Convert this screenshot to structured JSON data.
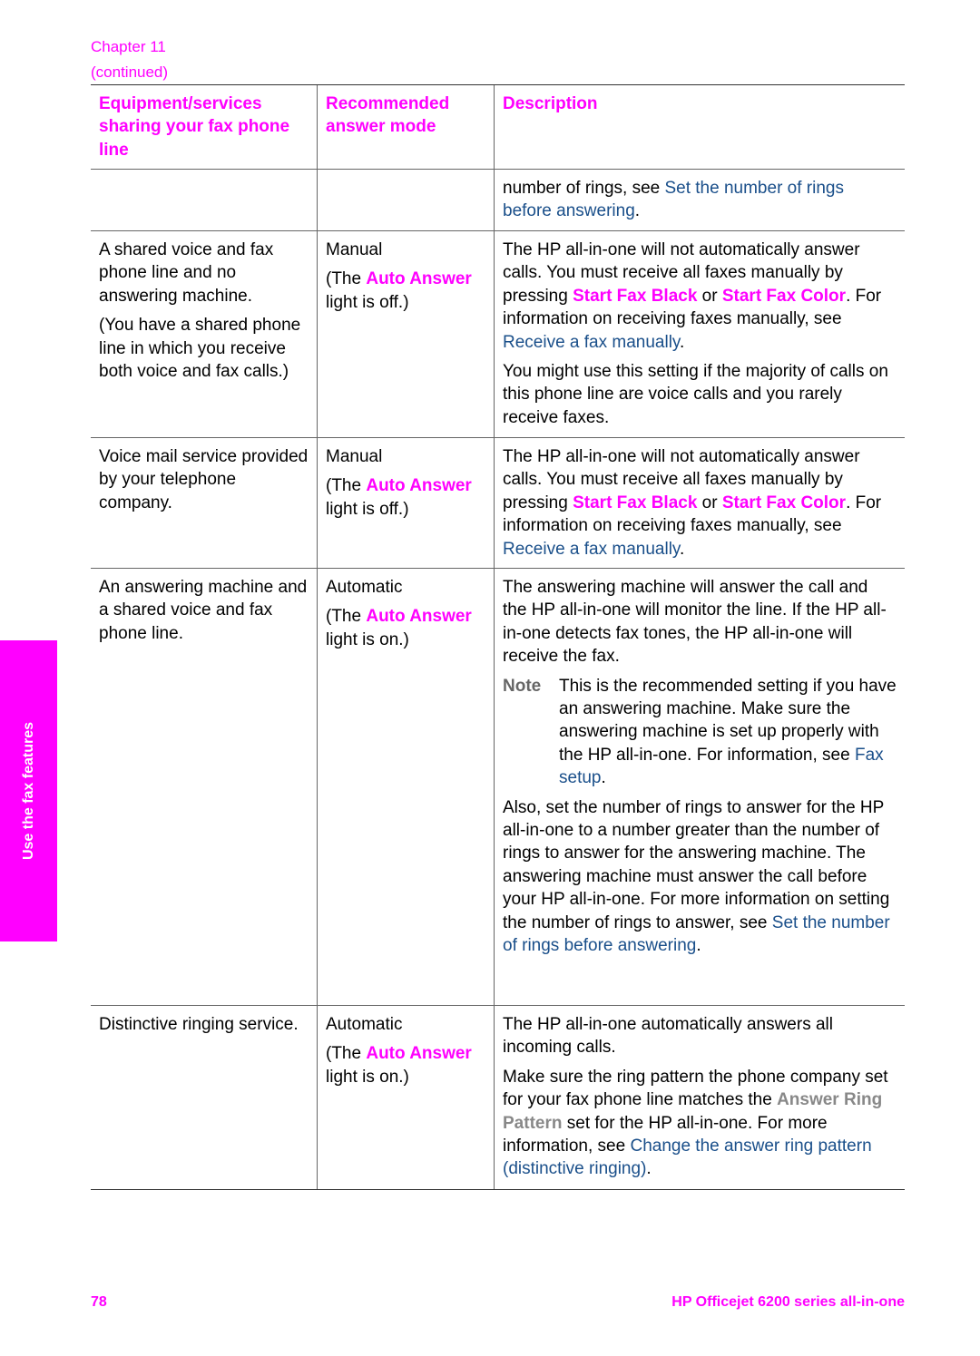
{
  "header": {
    "chapter": "Chapter 11",
    "continued": "(continued)"
  },
  "side_tab": {
    "label": "Use the fax features"
  },
  "table": {
    "headers": [
      "Equipment/services sharing your fax phone line",
      "Recommended answer mode",
      "Description"
    ],
    "rows": [
      {
        "equipment": "",
        "mode": "",
        "desc_prefix": "number of rings, see ",
        "desc_link": "Set the number of rings before answering",
        "desc_suffix": "."
      },
      {
        "equipment": "A shared voice and fax phone line and no answering machine.",
        "equipment_note": "(You have a shared phone line in which you receive both voice and fax calls.)",
        "mode": "Manual",
        "mode_pre": "(The ",
        "mode_ui": "Auto Answer",
        "mode_post": " light is off.)",
        "d1": "The HP all-in-one will not automatically answer calls. You must receive all faxes manually by pressing ",
        "d1_ui1": "Start Fax Black",
        "d1_or": " or ",
        "d1_ui2": "Start Fax Color",
        "d1_mid": ". For information on receiving faxes manually, see ",
        "d1_link": "Receive a fax manually",
        "d1_end": ".",
        "d2": "You might use this setting if the majority of calls on this phone line are voice calls and you rarely receive faxes."
      },
      {
        "equipment": "Voice mail service provided by your telephone company.",
        "mode": "Manual",
        "mode_pre": "(The ",
        "mode_ui": "Auto Answer",
        "mode_post": " light is off.)",
        "d1": "The HP all-in-one will not automatically answer calls. You must receive all faxes manually by pressing ",
        "d1_ui1": "Start Fax Black",
        "d1_or": " or ",
        "d1_ui2": "Start Fax Color",
        "d1_mid": ". For information on receiving faxes manually, see ",
        "d1_link": "Receive a fax manually",
        "d1_end": "."
      },
      {
        "equipment": "An answering machine and a shared voice and fax phone line.",
        "mode": "Automatic",
        "mode_pre": "(The ",
        "mode_ui": "Auto Answer",
        "mode_post": " light is on.)",
        "d1": "The answering machine will answer the call and the HP all-in-one will monitor the line. If the HP all-in-one detects fax tones, the HP all-in-one will receive the fax.",
        "note_label": "Note",
        "note_text": "This is the recommended setting if you have an answering machine. Make sure the answering machine is set up properly with the HP all-in-one. For information, see ",
        "note_link": "Fax setup",
        "note_end": ".",
        "d2": "Also, set the number of rings to answer for the HP all-in-one to a number greater than the number of rings to answer for the answering machine. The answering machine must answer the call before your HP all-in-one. For more information on setting the number of rings to answer, see ",
        "d2_link": "Set the number of rings before answering",
        "d2_end": "."
      },
      {
        "equipment": "Distinctive ringing service.",
        "mode": "Automatic",
        "mode_pre": "(The ",
        "mode_ui": "Auto Answer",
        "mode_post": " light is on.)",
        "d1": "The HP all-in-one automatically answers all incoming calls.",
        "d2": "Make sure the ring pattern the phone company set for your fax phone line matches the ",
        "d2_ui": "Answer Ring Pattern",
        "d2_mid": " set for the HP all-in-one. For more information, see ",
        "d2_link": "Change the answer ring pattern (distinctive ringing)",
        "d2_end": "."
      }
    ]
  },
  "footer": {
    "page_number": "78",
    "product": "HP Officejet 6200 series all-in-one"
  },
  "colors": {
    "accent": "#ff00ff",
    "link": "#1a4f8a",
    "ui_grey": "#888888"
  }
}
